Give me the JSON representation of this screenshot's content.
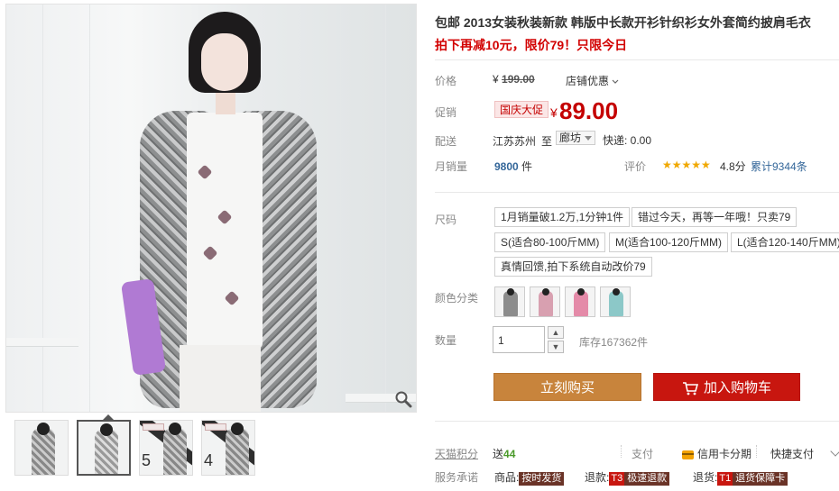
{
  "product": {
    "title": "包邮 2013女装秋装新款 韩版中长款开衫针织衫女外套简约披肩毛衣",
    "subtitle": "拍下再减10元，限价79！只限今日"
  },
  "price": {
    "label": "价格",
    "currency": "¥",
    "original": "199.00",
    "shop_discount": "店铺优惠"
  },
  "promo": {
    "label": "促销",
    "badge": "国庆大促",
    "currency": "¥",
    "price": "89.00"
  },
  "shipping": {
    "label": "配送",
    "from": "江苏苏州",
    "to_word": "至",
    "dest": "廊坊",
    "express": "快递: 0.00"
  },
  "sales": {
    "label": "月销量",
    "count": "9800",
    "unit": "件",
    "rating_label": "评价",
    "stars": "★★★★★",
    "score": "4.8分",
    "total": "累计9344条"
  },
  "sizes": {
    "label": "尺码",
    "options": [
      "1月销量破1.2万,1分钟1件",
      "错过今天，再等一年哦！只卖79",
      "S(适合80-100斤MM)",
      "M(适合100-120斤MM)",
      "L(适合120-140斤MM)",
      "真情回馈,拍下系统自动改价79"
    ]
  },
  "colors": {
    "label": "颜色分类",
    "swatch_colors": [
      "#8c8c8c",
      "#d8a0b0",
      "#e48aa8",
      "#8cc8c8"
    ]
  },
  "quantity": {
    "label": "数量",
    "value": "1",
    "stock": "库存167362件"
  },
  "buttons": {
    "buy_now": "立刻购买",
    "add_cart": "加入购物车"
  },
  "footer": {
    "points_label": "天猫积分",
    "points_prefix": "送",
    "points_value": "44",
    "pay_label": "支付",
    "credit": "信用卡分期",
    "quick_pay": "快捷支付",
    "service_label": "服务承诺",
    "goods_label": "商品:",
    "goods_tag": "按时发货",
    "refund_label": "退款:",
    "refund_code": "T3",
    "refund_tag": "极速退款",
    "return_label": "退货:",
    "return_code": "T1",
    "return_tag": "退货保障卡"
  },
  "icons": {
    "zoom": "zoom-magnifier-icon",
    "cart": "shopping-cart-icon",
    "credit_card": "credit-card-icon",
    "more": "chevron-down-icon"
  },
  "colors_theme": {
    "accent_red": "#c40000",
    "buy_orange": "#c8843c",
    "cart_red": "#c8160f",
    "link_blue": "#336699",
    "star_gold": "#f0a800"
  }
}
